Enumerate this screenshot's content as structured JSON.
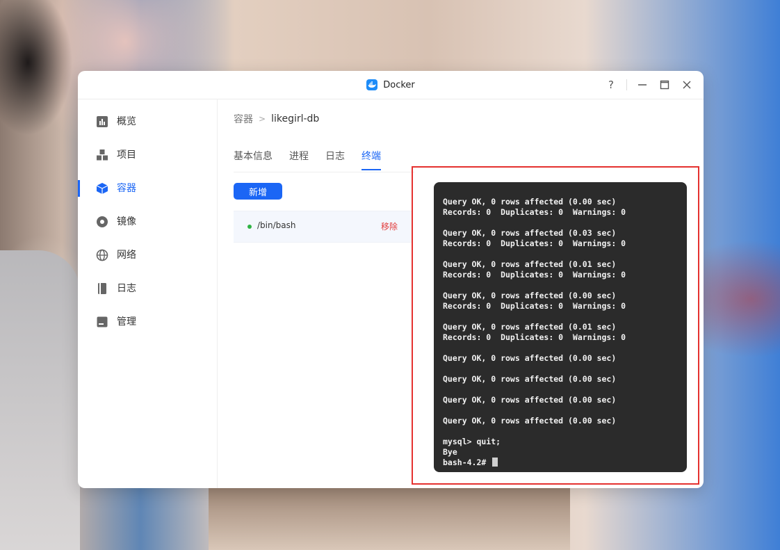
{
  "window": {
    "title": "Docker"
  },
  "sidebar": {
    "items": [
      {
        "label": "概览"
      },
      {
        "label": "项目"
      },
      {
        "label": "容器"
      },
      {
        "label": "镜像"
      },
      {
        "label": "网络"
      },
      {
        "label": "日志"
      },
      {
        "label": "管理"
      }
    ],
    "active_item": "容器"
  },
  "breadcrumb": {
    "parent": "容器",
    "current": "likegirl-db"
  },
  "tabs": [
    {
      "label": "基本信息"
    },
    {
      "label": "进程"
    },
    {
      "label": "日志"
    },
    {
      "label": "终端"
    }
  ],
  "active_tab": "终端",
  "toolbar": {
    "new_label": "新增"
  },
  "sessions": [
    {
      "name": "/bin/bash",
      "remove_label": "移除"
    }
  ],
  "terminal": {
    "output": "Query OK, 0 rows affected (0.00 sec)\nRecords: 0  Duplicates: 0  Warnings: 0\n\nQuery OK, 0 rows affected (0.03 sec)\nRecords: 0  Duplicates: 0  Warnings: 0\n\nQuery OK, 0 rows affected (0.01 sec)\nRecords: 0  Duplicates: 0  Warnings: 0\n\nQuery OK, 0 rows affected (0.00 sec)\nRecords: 0  Duplicates: 0  Warnings: 0\n\nQuery OK, 0 rows affected (0.01 sec)\nRecords: 0  Duplicates: 0  Warnings: 0\n\nQuery OK, 0 rows affected (0.00 sec)\n\nQuery OK, 0 rows affected (0.00 sec)\n\nQuery OK, 0 rows affected (0.00 sec)\n\nQuery OK, 0 rows affected (0.00 sec)\n\nmysql> quit;\nBye\n",
    "prompt": "bash-4.2# "
  },
  "colors": {
    "accent": "#1b66f5",
    "danger": "#e23b3b",
    "status_running": "#2fb344",
    "terminal_bg": "#2b2b2b",
    "highlight_border": "#e5312f"
  },
  "icons": {
    "app": "docker-whale-icon",
    "help": "question-icon",
    "minimize": "minimize-icon",
    "maximize": "maximize-icon",
    "close": "close-icon"
  }
}
